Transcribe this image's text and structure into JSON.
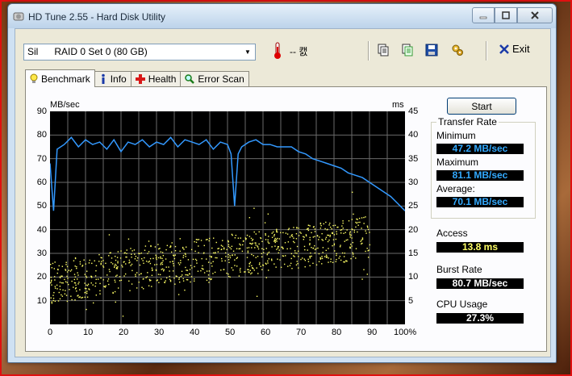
{
  "window": {
    "title": "HD Tune 2.55 - Hard Disk Utility"
  },
  "toolbar": {
    "drive": "Sil      RAID 0 Set 0 (80 GB)",
    "temperature": "-- 캜",
    "exit_label": "Exit"
  },
  "tabs": [
    {
      "label": "Benchmark",
      "active": true
    },
    {
      "label": "Info",
      "active": false
    },
    {
      "label": "Health",
      "active": false
    },
    {
      "label": "Error Scan",
      "active": false
    }
  ],
  "chart": {
    "left_unit": "MB/sec",
    "right_unit": "ms",
    "y_left_ticks": [
      "90",
      "80",
      "70",
      "60",
      "50",
      "40",
      "30",
      "20",
      "10"
    ],
    "y_right_ticks": [
      "45",
      "40",
      "35",
      "30",
      "25",
      "20",
      "15",
      "10",
      "5"
    ],
    "x_ticks": [
      "0",
      "10",
      "20",
      "30",
      "40",
      "50",
      "60",
      "70",
      "80",
      "90",
      "100%"
    ]
  },
  "chart_data": {
    "type": "line",
    "x_label": "",
    "x_range": [
      0,
      100
    ],
    "y_left_range": [
      0,
      90
    ],
    "y_right_range": [
      0,
      45
    ],
    "grid": true,
    "series": [
      {
        "axis": "left",
        "color": "#3399ff",
        "x": [
          0,
          1,
          2,
          4,
          6,
          8,
          10,
          12,
          14,
          16,
          18,
          20,
          22,
          24,
          26,
          28,
          30,
          32,
          34,
          36,
          38,
          40,
          42,
          44,
          46,
          48,
          50,
          51,
          52,
          53,
          54,
          56,
          58,
          60,
          62,
          64,
          66,
          68,
          70,
          72,
          74,
          76,
          78,
          80,
          82,
          84,
          86,
          88,
          90,
          92,
          94,
          96,
          98,
          100
        ],
        "y": [
          68,
          48,
          74,
          76,
          79,
          75,
          78,
          76,
          77,
          74,
          78,
          73,
          77,
          76,
          78,
          75,
          77,
          76,
          79,
          75,
          78,
          77,
          76,
          78,
          74,
          77,
          76,
          72,
          50,
          72,
          75,
          77,
          78,
          76,
          76,
          75,
          75,
          75,
          73,
          72,
          70,
          69,
          68,
          67,
          66,
          64,
          63,
          62,
          60,
          58,
          56,
          54,
          51,
          48
        ]
      },
      {
        "axis": "right",
        "color": "#ffff66",
        "type": "scatter",
        "trend_x": [
          0,
          10,
          20,
          30,
          40,
          50,
          60,
          70,
          80,
          90,
          100
        ],
        "trend_y": [
          9,
          10,
          11.5,
          12.5,
          13.5,
          14.5,
          15.5,
          16.5,
          17.5,
          18.5,
          19
        ]
      }
    ]
  },
  "start_label": "Start",
  "transfer": {
    "heading": "Transfer Rate",
    "min_label": "Minimum",
    "min_value": "47.2 MB/sec",
    "max_label": "Maximum",
    "max_value": "81.1 MB/sec",
    "avg_label": "Average:",
    "avg_value": "70.1 MB/sec"
  },
  "access": {
    "label": "Access",
    "value": "13.8 ms"
  },
  "burst": {
    "label": "Burst Rate",
    "value": "80.7 MB/sec"
  },
  "cpu": {
    "label": "CPU Usage",
    "value": "27.3%"
  },
  "colors": {
    "rate_value": "#33aaff",
    "access_value": "#ffff66",
    "white_value": "#ffffff"
  }
}
